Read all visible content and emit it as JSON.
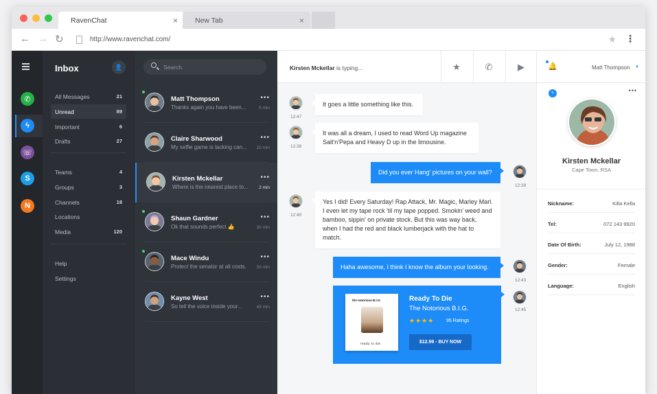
{
  "browser": {
    "tabs": [
      {
        "label": "RavenChat"
      },
      {
        "label": "New Tab"
      }
    ],
    "close_glyph": "×",
    "url": "http://www.ravenchat.com/"
  },
  "colors": {
    "accent": "#1d8cf8",
    "sidebar": "#2b2f35",
    "rail": "#23262b",
    "online": "#4cd964"
  },
  "rail": {
    "apps": [
      {
        "name": "whatsapp-icon",
        "glyph": "✆",
        "color": "#25b148"
      },
      {
        "name": "messenger-icon",
        "glyph": "ϟ",
        "color": "#1d8cf8"
      },
      {
        "name": "viber-icon",
        "glyph": "☏",
        "color": "#7b519d"
      },
      {
        "name": "skype-icon",
        "glyph": "S",
        "color": "#1c9ee8"
      },
      {
        "name": "app-n-icon",
        "glyph": "N",
        "color": "#f57a1f"
      }
    ]
  },
  "nav": {
    "title": "Inbox",
    "groups": [
      [
        {
          "label": "All Messages",
          "count": "21"
        },
        {
          "label": "Unread",
          "count": "89"
        },
        {
          "label": "Important",
          "count": "6"
        },
        {
          "label": "Drafts",
          "count": "27"
        }
      ],
      [
        {
          "label": "Teams",
          "count": "4"
        },
        {
          "label": "Groups",
          "count": "3"
        },
        {
          "label": "Channels",
          "count": "18"
        },
        {
          "label": "Locations",
          "count": ""
        },
        {
          "label": "Media",
          "count": "120"
        }
      ],
      [
        {
          "label": "Help",
          "count": ""
        },
        {
          "label": "Settings",
          "count": ""
        }
      ]
    ]
  },
  "chats": {
    "search_placeholder": "Search",
    "items": [
      {
        "name": "Matt Thompson",
        "preview": "Thanks again you have been...",
        "time": "5 min",
        "online": true
      },
      {
        "name": "Claire Sharwood",
        "preview": "My selfie game is lacking can...",
        "time": "10 min",
        "online": false
      },
      {
        "name": "Kirsten Mckellar",
        "preview": "Where is the nearest place to...",
        "time": "2 min",
        "online": false,
        "active": true
      },
      {
        "name": "Shaun Gardner",
        "preview": "Ok that sounds perfect 👍",
        "time": "30 min",
        "online": true
      },
      {
        "name": "Mace Windu",
        "preview": "Protect the senator at all costs.",
        "time": "30 min",
        "online": true
      },
      {
        "name": "Kayne West",
        "preview": "So tell the voice inside your...",
        "time": "49 min",
        "online": false
      }
    ]
  },
  "conversation": {
    "typing_name": "Kirsten Mckellar",
    "typing_text": " is typing...",
    "messages": [
      {
        "dir": "in",
        "text": "It goes a little something like this.",
        "time": "12:47"
      },
      {
        "dir": "in",
        "text": "It was all a dream, I used to read Word Up magazine Salt'n'Pepa and Heavy D up in the limousine.",
        "time": "12:38"
      },
      {
        "dir": "out",
        "text": "Did you ever Hang' pictures on your wall?",
        "time": "12:39"
      },
      {
        "dir": "in",
        "text": "Yes I did! Every Saturday! Rap Attack, Mr. Magic, Marley Marl. I even let my tape rock 'til my tape popped. Smokin' weed and bamboo, sippin' on private stock.  But this was way back, when I had the red and black lumberjack with the hat to match.",
        "time": "12:40"
      },
      {
        "dir": "out",
        "text": "Haha awesome,  I think I know the album your looking.",
        "time": "12:43"
      }
    ],
    "card": {
      "album_header": "the notorious B.I.G.",
      "album_footer": "ready to die",
      "title": "Ready To Die",
      "artist": "The Notorious B.I.G.",
      "stars": "★★★★",
      "ratings": "95 Ratings",
      "buy_label": "$12.99  -  BUY NOW",
      "time": "12:45"
    }
  },
  "profile": {
    "user": "Matt Thompson",
    "name": "Kirsten Mckellar",
    "location": "Cape Town, RSA",
    "fields": [
      {
        "key": "Nickname:",
        "value": "Killa Kella"
      },
      {
        "key": "Tel:",
        "value": "072 143 9920"
      },
      {
        "key": "Date Of Birth:",
        "value": "July 12, 1988"
      },
      {
        "key": "Gender:",
        "value": "Female"
      },
      {
        "key": "Language:",
        "value": "English"
      }
    ]
  }
}
